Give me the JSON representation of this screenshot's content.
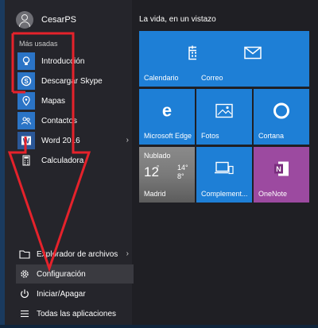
{
  "user": {
    "name": "CesarPS"
  },
  "left": {
    "section_label": "Más usadas",
    "apps": [
      {
        "label": "Introducción",
        "icon": "lightbulb-icon"
      },
      {
        "label": "Descargar Skype",
        "icon": "skype-icon"
      },
      {
        "label": "Mapas",
        "icon": "map-pin-icon"
      },
      {
        "label": "Contactos",
        "icon": "people-icon"
      },
      {
        "label": "Word 2016",
        "icon": "word-icon"
      },
      {
        "label": "Calculadora",
        "icon": "calculator-icon"
      }
    ],
    "bottom": [
      {
        "label": "Explorador de archivos",
        "icon": "folder-icon"
      },
      {
        "label": "Configuración",
        "icon": "gear-icon"
      },
      {
        "label": "Iniciar/Apagar",
        "icon": "power-icon"
      },
      {
        "label": "Todas las aplicaciones",
        "icon": "list-icon"
      }
    ]
  },
  "tiles": {
    "group_title": "La vida, en un vistazo",
    "calendar": "Calendario",
    "mail": "Correo",
    "edge": "Microsoft Edge",
    "photos": "Fotos",
    "cortana": "Cortana",
    "weather": {
      "condition": "Nublado",
      "temp": "12",
      "unit": "°",
      "high": "14°",
      "low": "8°",
      "city": "Madrid"
    },
    "complement": "Complement...",
    "onenote": "OneNote"
  },
  "colors": {
    "tile_blue": "#1e7fd6",
    "tile_purple": "#9c4aa0",
    "annotation_red": "#e5222b"
  }
}
